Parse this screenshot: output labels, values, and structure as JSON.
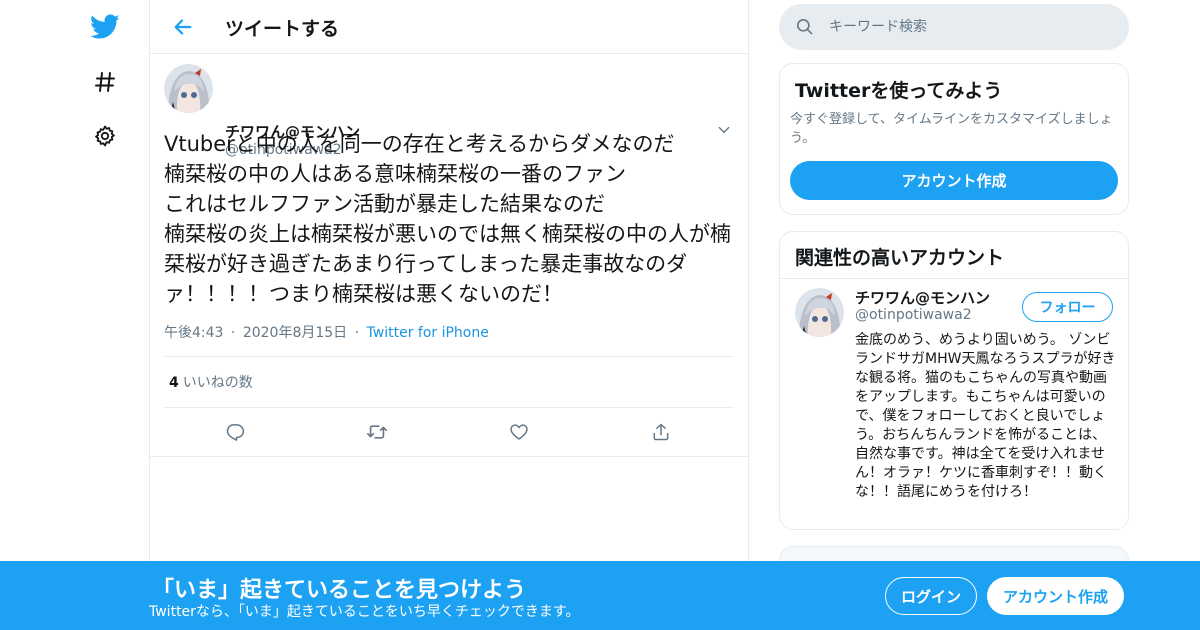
{
  "colors": {
    "accent": "#1da1f2",
    "secondary_text": "#657786",
    "border": "#e6ecf0"
  },
  "icons": {
    "nav": [
      "twitter-bird-icon",
      "hashtag-icon",
      "gear-icon"
    ],
    "header": "back-arrow-icon",
    "actions": [
      "reply-icon",
      "retweet-icon",
      "like-icon",
      "share-icon"
    ]
  },
  "header": {
    "title": "ツイートする"
  },
  "tweet": {
    "author_name": "チワワん@モンハン",
    "author_handle": "@otinpotiwawa2",
    "text": "Vtuberと中の人を同一の存在と考えるからダメなのだ\n楠栞桜の中の人はある意味楠栞桜の一番のファン\nこれはセルフファン活動が暴走した結果なのだ\n楠栞桜の炎上は楠栞桜が悪いのでは無く楠栞桜の中の人が楠栞桜が好き過ぎたあまり行ってしまった暴走事故なのダァ！！！！つまり楠栞桜は悪くないのだ！",
    "time": "午後4:43",
    "date": "2020年8月15日",
    "separator": "·",
    "source": "Twitter for iPhone",
    "likes_count": "4",
    "likes_label": "いいねの数"
  },
  "search": {
    "placeholder": "キーワード検索"
  },
  "try_card": {
    "title": "Twitterを使ってみよう",
    "description": "今すぐ登録して、タイムラインをカスタマイズしましょう。",
    "button": "アカウント作成"
  },
  "related_card": {
    "title": "関連性の高いアカウント",
    "name": "チワワん@モンハン",
    "handle": "@otinpotiwawa2",
    "follow_button": "フォロー",
    "bio": "金底のめう、めうより固いめう。 ゾンビランドサガMHW天鳳なろうスプラが好きな観る将。猫のもこちゃんの写真や動画をアップします。もこちゃんは可愛いので、僕をフォローしておくと良いでしょう。おちんちんランドを怖がることは、自然な事です。神は全てを受け入れません！オラァ！ケツに香車刺すぞ！！動くな！！語尾にめうを付けろ！"
  },
  "banner": {
    "title": "「いま」起きていることを見つけよう",
    "subtitle": "Twitterなら、「いま」起きていることをいち早くチェックできます。",
    "login_button": "ログイン",
    "signup_button": "アカウント作成"
  }
}
